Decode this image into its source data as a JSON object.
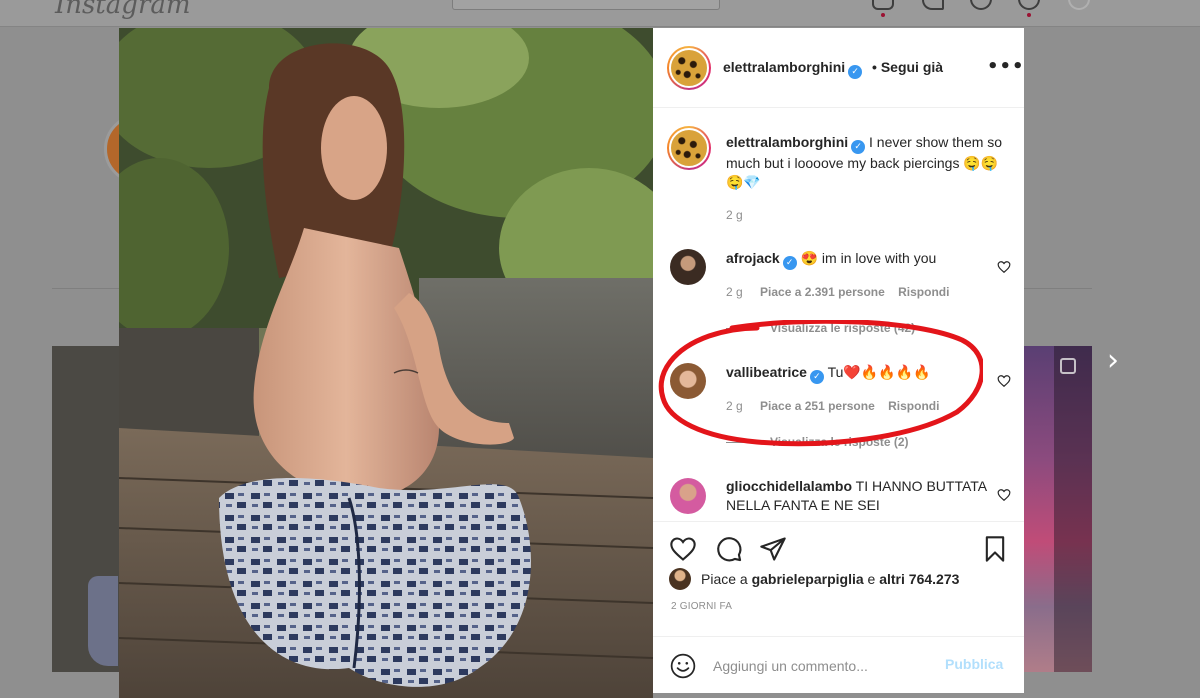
{
  "background": {
    "logo_text": "Instagram"
  },
  "post": {
    "author": {
      "username": "elettralamborghini",
      "verified": true,
      "follow_state": "• Segui già"
    },
    "caption": {
      "username": "elettralamborghini",
      "text": "I never show them so much but i loooove my back piercings 🤤🤤🤤💎",
      "time": "2 g"
    },
    "comments": [
      {
        "username": "afrojack",
        "verified": true,
        "text": "😍 im in love with you",
        "time": "2 g",
        "likes": "Piace a 2.391 persone",
        "reply_label": "Rispondi",
        "view_replies": "Visualizza le risposte (42)",
        "highlighted": true
      },
      {
        "username": "vallibeatrice",
        "verified": true,
        "text": "Tu❤️🔥🔥🔥🔥",
        "time": "2 g",
        "likes": "Piace a 251 persone",
        "reply_label": "Rispondi",
        "view_replies": "Visualizza le risposte (2)"
      },
      {
        "username": "gliocchidellalambo",
        "verified": false,
        "text": "TI HANNO BUTTATA NELLA FANTA E NE SEI"
      }
    ],
    "likes_summary": {
      "prefix": "Piace a",
      "user": "gabrieleparpiglia",
      "joiner": "e",
      "others": "altri 764.273"
    },
    "timestamp": "2 GIORNI FA",
    "add_comment": {
      "placeholder": "Aggiungi un commento...",
      "publish_label": "Pubblica"
    }
  },
  "icons": {
    "more": "more-options-icon",
    "like": "heart-icon",
    "comment": "comment-bubble-icon",
    "share": "paper-plane-icon",
    "save": "bookmark-icon",
    "emoji": "emoji-smile-icon",
    "next": "chevron-right-icon"
  },
  "colors": {
    "link_blue": "#3897f0",
    "publish_disabled": "#b2dffc",
    "annotation_red": "#e3151a"
  }
}
